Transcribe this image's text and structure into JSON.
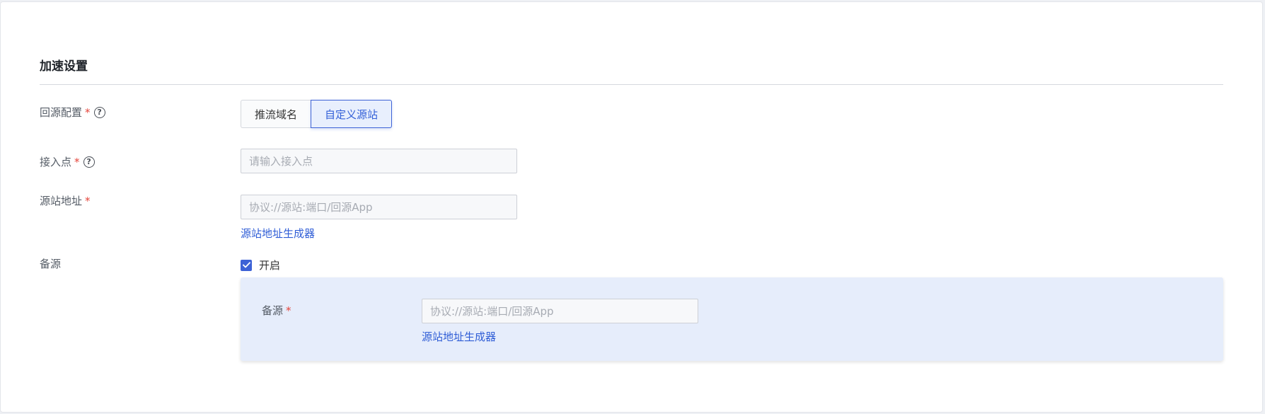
{
  "section": {
    "title": "加速设置"
  },
  "origin_config": {
    "label": "回源配置",
    "required_mark": "*",
    "options": [
      "推流域名",
      "自定义源站"
    ],
    "selected": "自定义源站"
  },
  "access_point": {
    "label": "接入点",
    "required_mark": "*",
    "placeholder": "请输入接入点",
    "value": ""
  },
  "origin_address": {
    "label": "源站地址",
    "required_mark": "*",
    "placeholder": "协议://源站:端口/回源App",
    "value": "",
    "generator_link": "源站地址生成器"
  },
  "backup": {
    "label": "备源",
    "checkbox_label": "开启",
    "checked": true,
    "field": {
      "label": "备源",
      "required_mark": "*",
      "placeholder": "协议://源站:端口/回源App",
      "value": "",
      "generator_link": "源站地址生成器"
    }
  },
  "colors": {
    "accent": "#3d62d6",
    "link": "#2f5dd6",
    "required": "#e5453b",
    "panel_bg": "#e6edfb"
  }
}
